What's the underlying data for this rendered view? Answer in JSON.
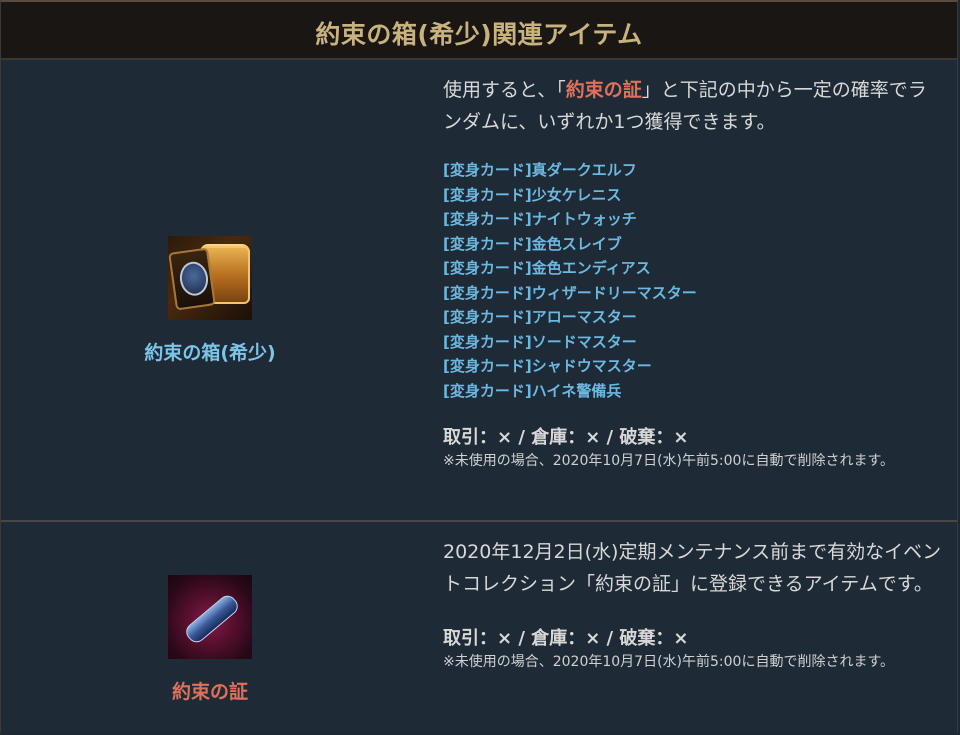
{
  "header": {
    "title": "約束の箱(希少)関連アイテム"
  },
  "items": [
    {
      "name": "約束の箱(希少)",
      "icon": "treasure-chest-with-card-icon",
      "desc_before": "使用すると、「",
      "desc_highlight": "約束の証",
      "desc_after": "」と下記の中から一定の確率でランダムに、いずれか1つ獲得できます。",
      "cards": [
        "[変身カード]真ダークエルフ",
        "[変身カード]少女ケレニス",
        "[変身カード]ナイトウォッチ",
        "[変身カード]金色スレイブ",
        "[変身カード]金色エンディアス",
        "[変身カード]ウィザードリーマスター",
        "[変身カード]アローマスター",
        "[変身カード]ソードマスター",
        "[変身カード]シャドウマスター",
        "[変身カード]ハイネ警備兵"
      ],
      "trade": "取引：× / 倉庫：× / 破棄：×",
      "note": "※未使用の場合、2020年10月7日(水)午前5:00に自動で削除されます。"
    },
    {
      "name": "約束の証",
      "icon": "scroll-icon",
      "desc": "2020年12月2日(水)定期メンテナンス前まで有効なイベントコレクション「約束の証」に登録できるアイテムです。",
      "trade": "取引：× / 倉庫：× / 破棄：×",
      "note": "※未使用の場合、2020年10月7日(水)午前5:00に自動で削除されます。"
    }
  ],
  "colors": {
    "header_text": "#c8b27e",
    "link_blue": "#7cc4e8",
    "highlight_red": "#e0705a",
    "background": "#1e2a36"
  }
}
